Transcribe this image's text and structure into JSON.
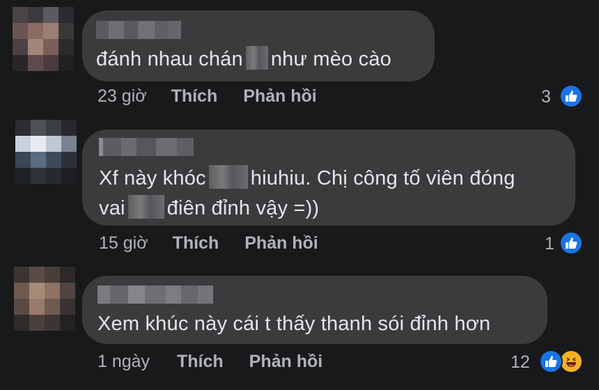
{
  "colors": {
    "background": "#18191a",
    "bubble": "#3a3b3c",
    "text": "#e4e6eb",
    "meta": "#b0b3b8",
    "like": "#1b74e4",
    "haha": "#f7b125"
  },
  "comments": [
    {
      "text_before": "đánh nhau chán",
      "text_after": "như mèo cào",
      "time": "23 giờ",
      "like_label": "Thích",
      "reply_label": "Phản hồi",
      "reaction_count": "3",
      "reactions": [
        "like-icon"
      ]
    },
    {
      "line1_before": "Xf này khóc",
      "line1_after": "hiuhiu. Chị công tố viên đóng",
      "line2_before": "vai",
      "line2_after": "điên đỉnh vậy =))",
      "time": "15 giờ",
      "like_label": "Thích",
      "reply_label": "Phản hồi",
      "reaction_count": "1",
      "reactions": [
        "like-icon"
      ]
    },
    {
      "text": "Xem khúc này cái t thấy thanh sói đỉnh hơn",
      "time": "1 ngày",
      "like_label": "Thích",
      "reply_label": "Phản hồi",
      "reaction_count": "12",
      "reactions": [
        "like-icon",
        "haha-icon"
      ]
    }
  ]
}
